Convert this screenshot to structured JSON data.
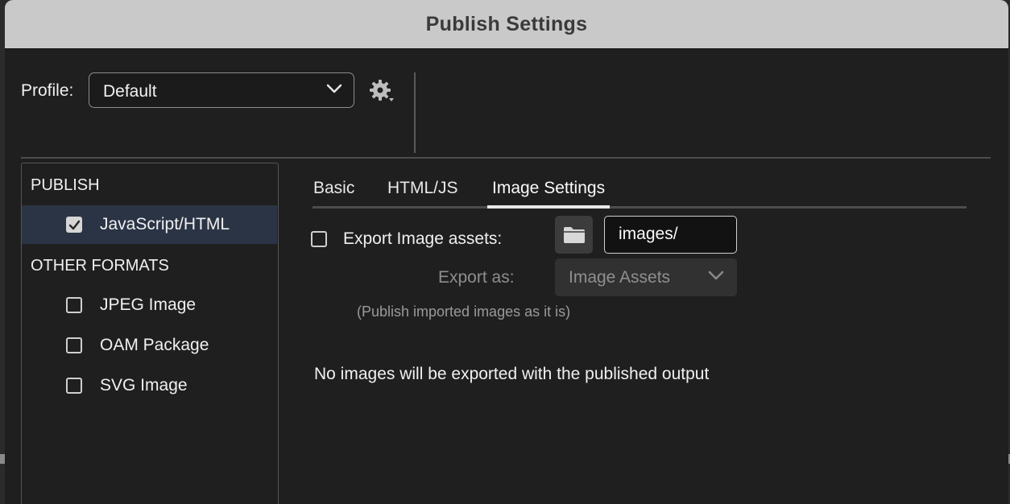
{
  "window": {
    "title": "Publish Settings"
  },
  "profile": {
    "label": "Profile:",
    "value": "Default"
  },
  "sidebar": {
    "publish_heading": "PUBLISH",
    "publish_items": [
      {
        "label": "JavaScript/HTML",
        "checked": true,
        "selected": true
      }
    ],
    "other_heading": "OTHER FORMATS",
    "other_items": [
      {
        "label": "JPEG Image",
        "checked": false
      },
      {
        "label": "OAM Package",
        "checked": false
      },
      {
        "label": "SVG Image",
        "checked": false
      }
    ]
  },
  "tabs": [
    {
      "label": "Basic",
      "active": false
    },
    {
      "label": "HTML/JS",
      "active": false
    },
    {
      "label": "Image Settings",
      "active": true
    }
  ],
  "image_settings": {
    "export_assets_label": "Export Image assets:",
    "export_assets_checked": false,
    "folder_path": "images/",
    "export_as_label": "Export as:",
    "export_as_value": "Image Assets",
    "hint": "(Publish imported images as it is)",
    "notice": "No images will be exported with the published output"
  },
  "icons": {
    "profile_chevron": "chevron-down-icon",
    "gear": "gear-icon",
    "folder": "folder-icon",
    "checkmark": "checkmark-icon"
  },
  "colors": {
    "titlebar": "#c9c9c9",
    "panel_bg": "#1f1f1f",
    "selected_row": "#2a3445"
  }
}
